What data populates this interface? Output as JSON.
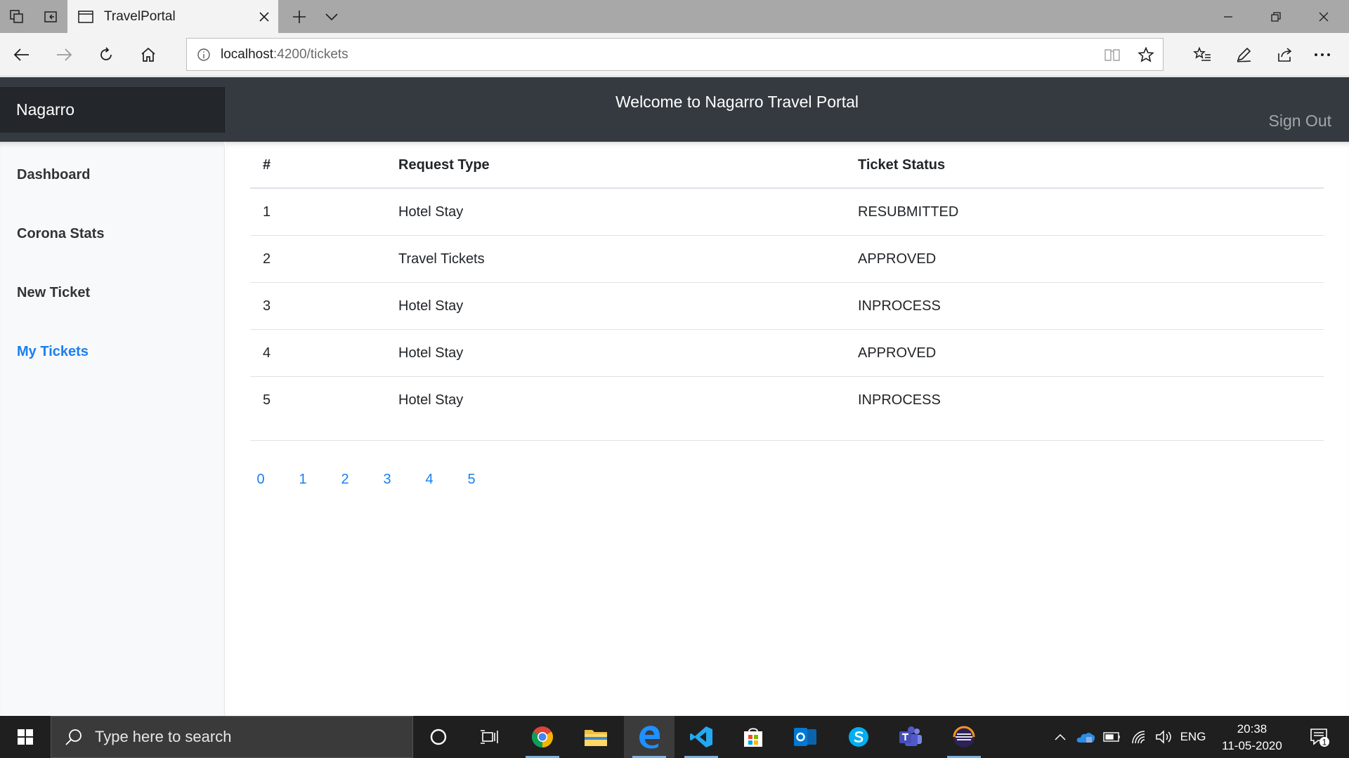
{
  "browser": {
    "tab_title": "TravelPortal",
    "url_host": "localhost",
    "url_path": ":4200/tickets"
  },
  "header": {
    "brand": "Nagarro",
    "welcome": "Welcome to Nagarro Travel Portal",
    "signout": "Sign Out"
  },
  "sidebar": {
    "items": [
      {
        "label": "Dashboard",
        "active": false
      },
      {
        "label": "Corona Stats",
        "active": false
      },
      {
        "label": "New Ticket",
        "active": false
      },
      {
        "label": "My Tickets",
        "active": true
      }
    ]
  },
  "table": {
    "headers": [
      "#",
      "Request Type",
      "Ticket Status"
    ],
    "rows": [
      {
        "num": "1",
        "type": "Hotel Stay",
        "status": "RESUBMITTED"
      },
      {
        "num": "2",
        "type": "Travel Tickets",
        "status": "APPROVED"
      },
      {
        "num": "3",
        "type": "Hotel Stay",
        "status": "INPROCESS"
      },
      {
        "num": "4",
        "type": "Hotel Stay",
        "status": "APPROVED"
      },
      {
        "num": "5",
        "type": "Hotel Stay",
        "status": "INPROCESS"
      }
    ]
  },
  "pagination": [
    "0",
    "1",
    "2",
    "3",
    "4",
    "5"
  ],
  "taskbar": {
    "search_placeholder": "Type here to search",
    "language": "ENG",
    "time": "20:38",
    "date": "11-05-2020",
    "notification_count": "1"
  },
  "colors": {
    "header_bg": "#343a40",
    "link_blue": "#1a7ff0",
    "sidebar_bg": "#f8f9fa"
  }
}
